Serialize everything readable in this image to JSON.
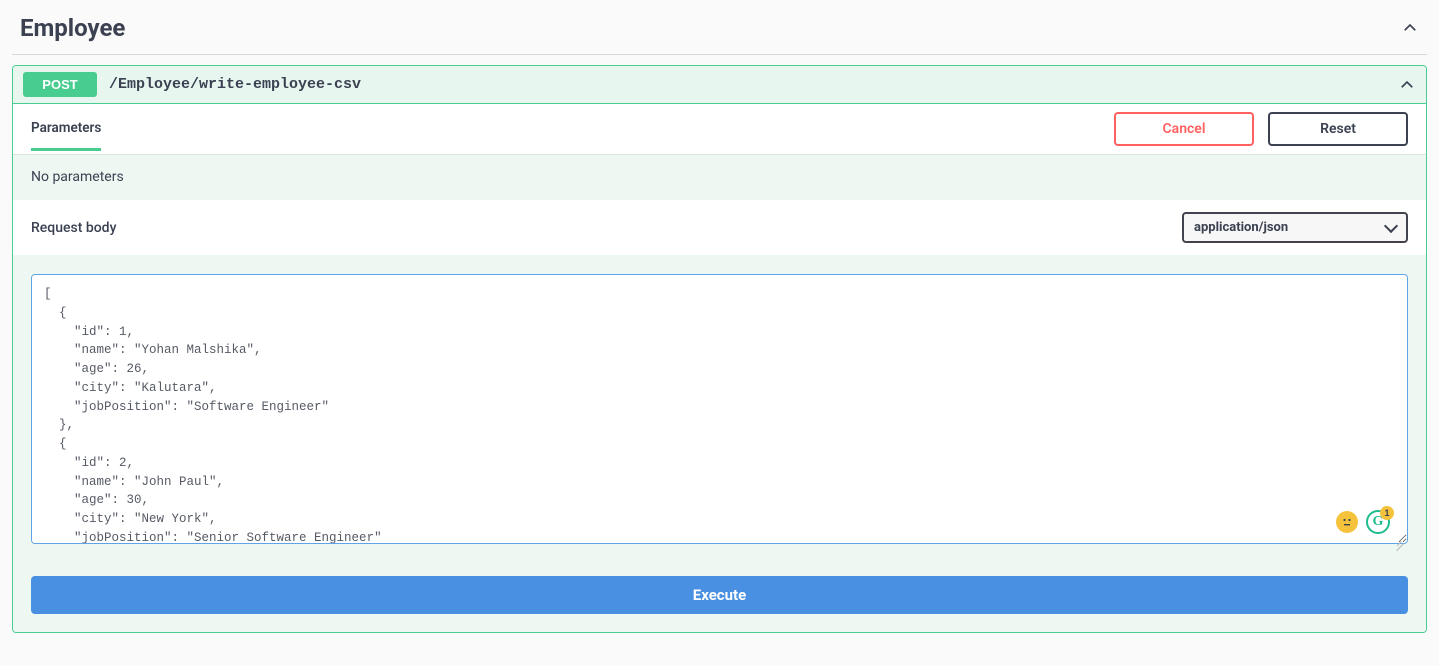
{
  "section": {
    "title": "Employee"
  },
  "operation": {
    "method": "POST",
    "path": "/Employee/write-employee-csv"
  },
  "tabs": {
    "parameters": "Parameters"
  },
  "buttons": {
    "cancel": "Cancel",
    "reset": "Reset",
    "execute": "Execute"
  },
  "labels": {
    "no_parameters": "No parameters",
    "request_body": "Request body"
  },
  "content_type": {
    "selected": "application/json"
  },
  "request_body_value": "[\n  {\n    \"id\": 1,\n    \"name\": \"Yohan Malshika\",\n    \"age\": 26,\n    \"city\": \"Kalutara\",\n    \"jobPosition\": \"Software Engineer\"\n  },\n  {\n    \"id\": 2,\n    \"name\": \"John Paul\",\n    \"age\": 30,\n    \"city\": \"New York\",\n    \"jobPosition\": \"Senior Software Engineer\"\n  }\n]",
  "grammarly_badge": "1",
  "grammarly_letter": "G"
}
